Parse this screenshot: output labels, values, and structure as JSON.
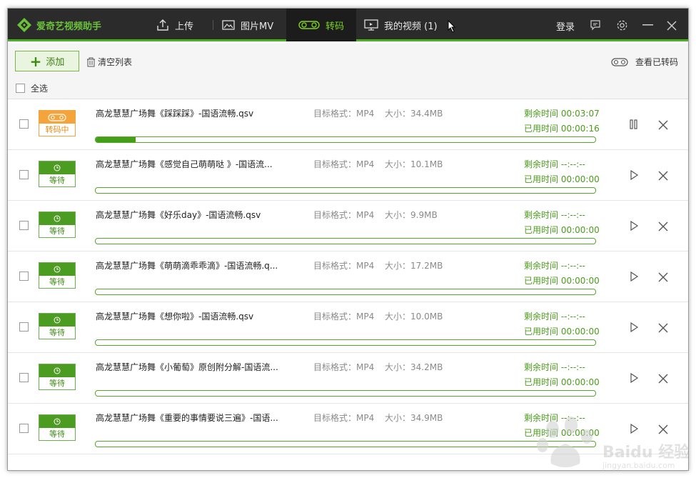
{
  "app": {
    "title": "爱奇艺视频助手",
    "accent": "#4caf1f"
  },
  "nav": {
    "tabs": [
      {
        "label": "上传",
        "icon": "upload-icon"
      },
      {
        "label": "图片MV",
        "icon": "image-icon"
      },
      {
        "label": "转码",
        "icon": "transcode-icon",
        "active": true
      },
      {
        "label": "我的视频 (1)",
        "icon": "monitor-icon"
      }
    ],
    "login": "登录"
  },
  "toolbar": {
    "add_label": "添加",
    "clear_label": "清空列表",
    "view_done_label": "查看已转码",
    "select_all_label": "全选"
  },
  "rows": [
    {
      "name": "高龙慧慧广场舞《踩踩踩》-国语流畅.qsv",
      "format": "目标格式：MP4",
      "size": "大小：34.4MB",
      "status": "转码中",
      "remaining": "剩余时间 00:03:07",
      "used": "已用时间 00:00:16",
      "progress": 0.08,
      "action": "pause"
    },
    {
      "name": "高龙慧慧广场舞《感觉自己萌萌哒 》-国语流...",
      "format": "目标格式：MP4",
      "size": "大小：10.1MB",
      "status": "等待",
      "remaining": "剩余时间 --:--:--",
      "used": "已用时间 00:00:00",
      "progress": 0,
      "action": "play"
    },
    {
      "name": "高龙慧慧广场舞《好乐day》-国语流畅.qsv",
      "format": "目标格式：MP4",
      "size": "大小：9.9MB",
      "status": "等待",
      "remaining": "剩余时间 --:--:--",
      "used": "已用时间 00:00:00",
      "progress": 0,
      "action": "play"
    },
    {
      "name": "高龙慧慧广场舞《萌萌滴乖乖滴》-国语流畅.q...",
      "format": "目标格式：MP4",
      "size": "大小：17.2MB",
      "status": "等待",
      "remaining": "剩余时间 --:--:--",
      "used": "已用时间 00:00:00",
      "progress": 0,
      "action": "play"
    },
    {
      "name": "高龙慧慧广场舞《想你啦》-国语流畅.qsv",
      "format": "目标格式：MP4",
      "size": "大小：10.0MB",
      "status": "等待",
      "remaining": "剩余时间 --:--:--",
      "used": "已用时间 00:00:00",
      "progress": 0,
      "action": "play"
    },
    {
      "name": "高龙慧慧广场舞《小葡萄》原创附分解-国语流...",
      "format": "目标格式：MP4",
      "size": "大小：34.2MB",
      "status": "等待",
      "remaining": "剩余时间 --:--:--",
      "used": "已用时间 00:00:00",
      "progress": 0,
      "action": "play"
    },
    {
      "name": "高龙慧慧广场舞《重要的事情要说三遍》-国语...",
      "format": "目标格式：MP4",
      "size": "大小：34.9MB",
      "status": "等待",
      "remaining": "剩余时间 --:--:--",
      "used": "已用时间 00:00:00",
      "progress": 0,
      "action": "play"
    }
  ],
  "watermark": {
    "text": "Baidu 经验",
    "url": "jingyan.baidu.com"
  }
}
